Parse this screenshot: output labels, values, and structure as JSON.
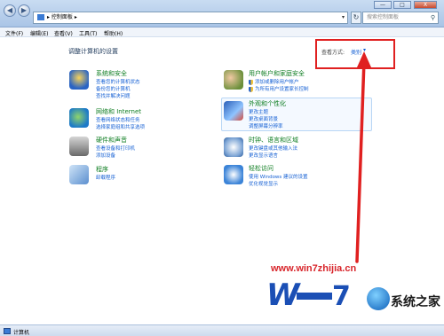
{
  "window": {
    "nav_back": "◀",
    "nav_forward": "▶",
    "address": "▸ 控制面板 ▸",
    "address_chevron": "▾",
    "refresh": "↻",
    "search_placeholder": "搜索控制面板",
    "search_icon": "search-icon",
    "controls": {
      "minimize": "—",
      "maximize": "□",
      "close": "X"
    }
  },
  "menu": [
    "文件(F)",
    "编辑(E)",
    "查看(V)",
    "工具(T)",
    "帮助(H)"
  ],
  "page": {
    "title": "调整计算机的设置",
    "view_by_label": "查看方式:",
    "view_by_value": "类别",
    "view_by_chevron": "▾"
  },
  "categories_left": [
    {
      "title": "系统和安全",
      "icon": "shield-flag-icon",
      "links": [
        "查看您的计算机状态",
        "备份您的计算机",
        "查找并解决问题"
      ]
    },
    {
      "title": "网络和 Internet",
      "icon": "globe-network-icon",
      "links": [
        "查看网络状态和任务",
        "选择家庭组和共享选项"
      ]
    },
    {
      "title": "硬件和声音",
      "icon": "printer-speaker-icon",
      "links": [
        "查看设备和打印机",
        "添加设备"
      ]
    },
    {
      "title": "程序",
      "icon": "programs-icon",
      "links": [
        "卸载程序"
      ]
    }
  ],
  "categories_right": [
    {
      "title": "用户帐户和家庭安全",
      "icon": "users-icon",
      "links": [
        "添加或删除用户帐户",
        "为所有用户设置家长控制"
      ]
    },
    {
      "title": "外观和个性化",
      "icon": "monitor-paint-icon",
      "links": [
        "更改主题",
        "更改桌面背景",
        "调整屏幕分辨率"
      ]
    },
    {
      "title": "时钟、语言和区域",
      "icon": "clock-globe-icon",
      "links": [
        "更改键盘或其他输入法",
        "更改显示语言"
      ]
    },
    {
      "title": "轻松访问",
      "icon": "accessibility-icon",
      "links": [
        "使用 Windows 建议的设置",
        "优化视觉显示"
      ]
    }
  ],
  "watermark": {
    "url": "www.win7zhijia.cn",
    "brand": "系统之家"
  },
  "status": {
    "text": "计算机"
  },
  "colors": {
    "category_title": "#0d7d20",
    "link": "#1560d4",
    "highlight": "#e02020"
  }
}
